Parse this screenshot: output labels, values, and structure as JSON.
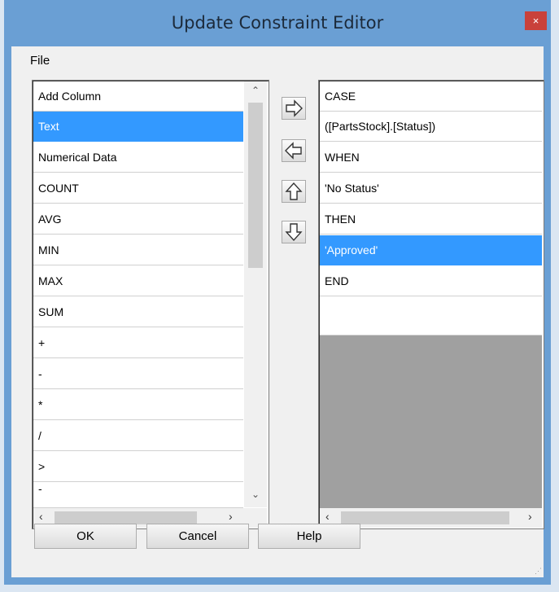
{
  "window": {
    "title": "Update Constraint Editor",
    "close_glyph": "×"
  },
  "menu": {
    "file": "File"
  },
  "left_list": {
    "items": [
      "Add Column",
      "Text",
      "Numerical Data",
      "COUNT",
      "AVG",
      "MIN",
      "MAX",
      "SUM",
      "+",
      "-",
      "*",
      "/",
      ">",
      "-"
    ],
    "selected_index": 1
  },
  "right_list": {
    "items": [
      "CASE",
      "([PartsStock].[Status])",
      "WHEN",
      "'No Status'",
      "THEN",
      "'Approved'",
      "END",
      ""
    ],
    "selected_index": 5
  },
  "arrow_buttons": [
    "arrow-right-icon",
    "arrow-left-icon",
    "arrow-up-icon",
    "arrow-down-icon"
  ],
  "buttons": {
    "ok": "OK",
    "cancel": "Cancel",
    "help": "Help"
  },
  "colors": {
    "titlebar": "#6a9fd4",
    "selection": "#3399ff",
    "close": "#c9413a"
  }
}
